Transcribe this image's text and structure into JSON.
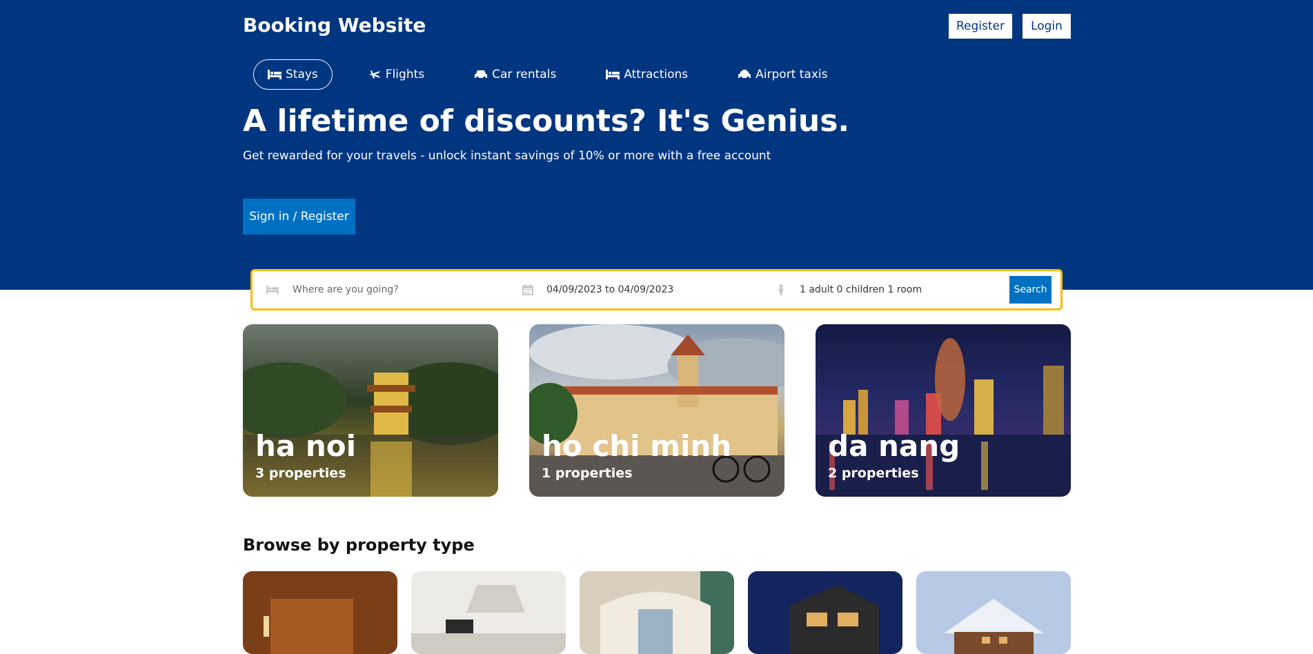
{
  "header": {
    "brand": "Booking Website",
    "register_label": "Register",
    "login_label": "Login"
  },
  "nav": {
    "items": [
      {
        "label": "Stays",
        "icon": "bed-icon",
        "active": true
      },
      {
        "label": "Flights",
        "icon": "plane-icon",
        "active": false
      },
      {
        "label": "Car rentals",
        "icon": "car-icon",
        "active": false
      },
      {
        "label": "Attractions",
        "icon": "bed-icon",
        "active": false
      },
      {
        "label": "Airport taxis",
        "icon": "taxi-icon",
        "active": false
      }
    ]
  },
  "hero": {
    "headline": "A lifetime of discounts? It's Genius.",
    "subtitle": "Get rewarded for your travels - unlock instant savings of 10% or more with a free account",
    "cta_label": "Sign in / Register"
  },
  "search": {
    "destination_placeholder": "Where are you going?",
    "dates": "04/09/2023 to 04/09/2023",
    "guests": "1 adult 0 children 1 room",
    "button_label": "Search"
  },
  "cities": [
    {
      "name": "ha noi",
      "properties": "3 properties"
    },
    {
      "name": "ho chi minh",
      "properties": "1 properties"
    },
    {
      "name": "da nang",
      "properties": "2 properties"
    }
  ],
  "property_types": {
    "heading": "Browse by property type"
  },
  "colors": {
    "brand": "#003580",
    "accent": "#0071c2",
    "search_border": "#febb02"
  }
}
